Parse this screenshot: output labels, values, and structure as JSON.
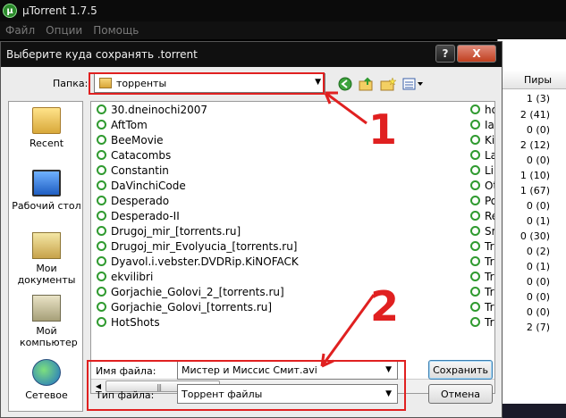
{
  "app": {
    "title": "µTorrent 1.7.5",
    "menu": [
      "Файл",
      "Опции",
      "Помощь"
    ]
  },
  "background_panel": {
    "column_header": "Пиры",
    "peers": [
      "1 (3)",
      "2 (41)",
      "0 (0)",
      "2 (12)",
      "0 (0)",
      "1 (10)",
      "1 (67)",
      "0 (0)",
      "0 (1)",
      "0 (30)",
      "0 (2)",
      "0 (1)",
      "0 (0)",
      "0 (0)",
      "0 (0)",
      "2 (7)"
    ]
  },
  "dialog": {
    "title": "Выберите куда сохранять .torrent",
    "help_glyph": "?",
    "close_glyph": "X",
    "folder_label": "Папка:",
    "folder_value": "торренты",
    "places": [
      {
        "label": "Recent",
        "icon": "recent-folder-icon"
      },
      {
        "label": "Рабочий стол",
        "icon": "desktop-icon"
      },
      {
        "label": "Мои документы",
        "icon": "documents-icon"
      },
      {
        "label": "Мой компьютер",
        "icon": "computer-icon"
      },
      {
        "label": "Сетевое",
        "icon": "network-icon"
      }
    ],
    "files_col1": [
      "30.dneinochi2007",
      "AftTom",
      "BeeMovie",
      "Catacombs",
      "Constantin",
      "DaVinchiCode",
      "Desperado",
      "Desperado-II",
      "Drugoj_mir_[torrents.ru]",
      "Drugoj_mir_Evolyucia_[torrents.ru]",
      "Dyavol.i.vebster.DVDRip.KiNOFACK",
      "ekvilibri",
      "Gorjachie_Golovi_2_[torrents.ru]",
      "Gorjachie_Golovi_[torrents.ru]",
      "HotShots"
    ],
    "files_col2": [
      "ho",
      "Ia:",
      "Ki",
      "La",
      "Li",
      "Ot",
      "Po",
      "Re",
      "Sr",
      "Tr",
      "Tr",
      "Tr",
      "Tr",
      "Tr",
      "Tr"
    ],
    "filename_label": "Имя файла:",
    "filename_value": "Мистер и Миссис Смит.avi",
    "filetype_label": "Тип файла:",
    "filetype_value": "Торрент файлы",
    "save_button": "Сохранить",
    "cancel_button": "Отмена"
  },
  "annotations": {
    "marker_1": "1",
    "marker_2": "2",
    "color": "#e02020"
  }
}
